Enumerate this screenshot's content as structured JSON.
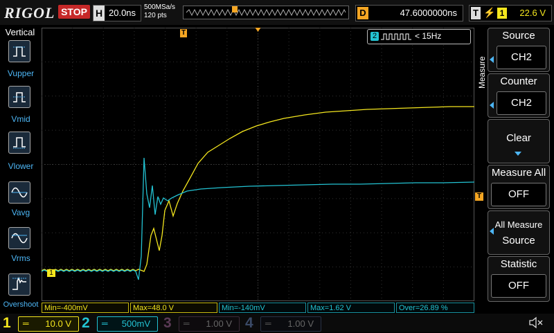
{
  "header": {
    "logo": "RIGOL",
    "run_status": "STOP",
    "timebase_key": "H",
    "timebase": "20.0ns",
    "sample_rate": "500MSa/s",
    "points": "120 pts",
    "delay_key": "D",
    "delay": "47.6000000ns",
    "trigger_key": "T",
    "trigger_source": "1",
    "trigger_level": "22.6 V"
  },
  "left_menu": {
    "title": "Vertical",
    "items": [
      {
        "label": "Vupper",
        "icon": "vupper-icon"
      },
      {
        "label": "Vmid",
        "icon": "vmid-icon"
      },
      {
        "label": "Vlower",
        "icon": "vlower-icon"
      },
      {
        "label": "Vavg",
        "icon": "vavg-icon"
      },
      {
        "label": "Vrms",
        "icon": "vrms-icon"
      },
      {
        "label": "Overshoot",
        "icon": "overshoot-icon"
      }
    ]
  },
  "freq_counter": {
    "channel": "2",
    "text": "< 15Hz"
  },
  "right_menu": {
    "title": "Measure",
    "items": [
      {
        "title": "Source",
        "value": "CH2"
      },
      {
        "title": "Counter",
        "value": "CH2"
      },
      {
        "title": "Clear",
        "value": ""
      },
      {
        "title": "Measure All",
        "value": "OFF"
      },
      {
        "title": "All Measure",
        "value": "Source"
      },
      {
        "title": "Statistic",
        "value": "OFF"
      }
    ]
  },
  "markers": {
    "ch1": "1",
    "trigger": "T"
  },
  "measurements": [
    {
      "text": "Min=-400mV",
      "color": "yellow"
    },
    {
      "text": "Max=48.0 V",
      "color": "yellow"
    },
    {
      "text": "Min=-140mV",
      "color": "cyan"
    },
    {
      "text": "Max=1.62 V",
      "color": "cyan"
    },
    {
      "text": "Over=26.89 %",
      "color": "cyan"
    }
  ],
  "channels": [
    {
      "num": "1",
      "scale": "10.0 V",
      "color": "#f5e71e",
      "active": true
    },
    {
      "num": "2",
      "scale": "500mV",
      "color": "#23c3d3",
      "active": true
    },
    {
      "num": "3",
      "scale": "1.00 V",
      "color": "#8a3a7a",
      "active": false
    },
    {
      "num": "4",
      "scale": "1.00 V",
      "color": "#3b5a9a",
      "active": false
    }
  ],
  "colors": {
    "ch1": "#f5e71e",
    "ch2": "#23c3d3",
    "trigger": "#f5a623",
    "accent": "#4db6f5"
  }
}
